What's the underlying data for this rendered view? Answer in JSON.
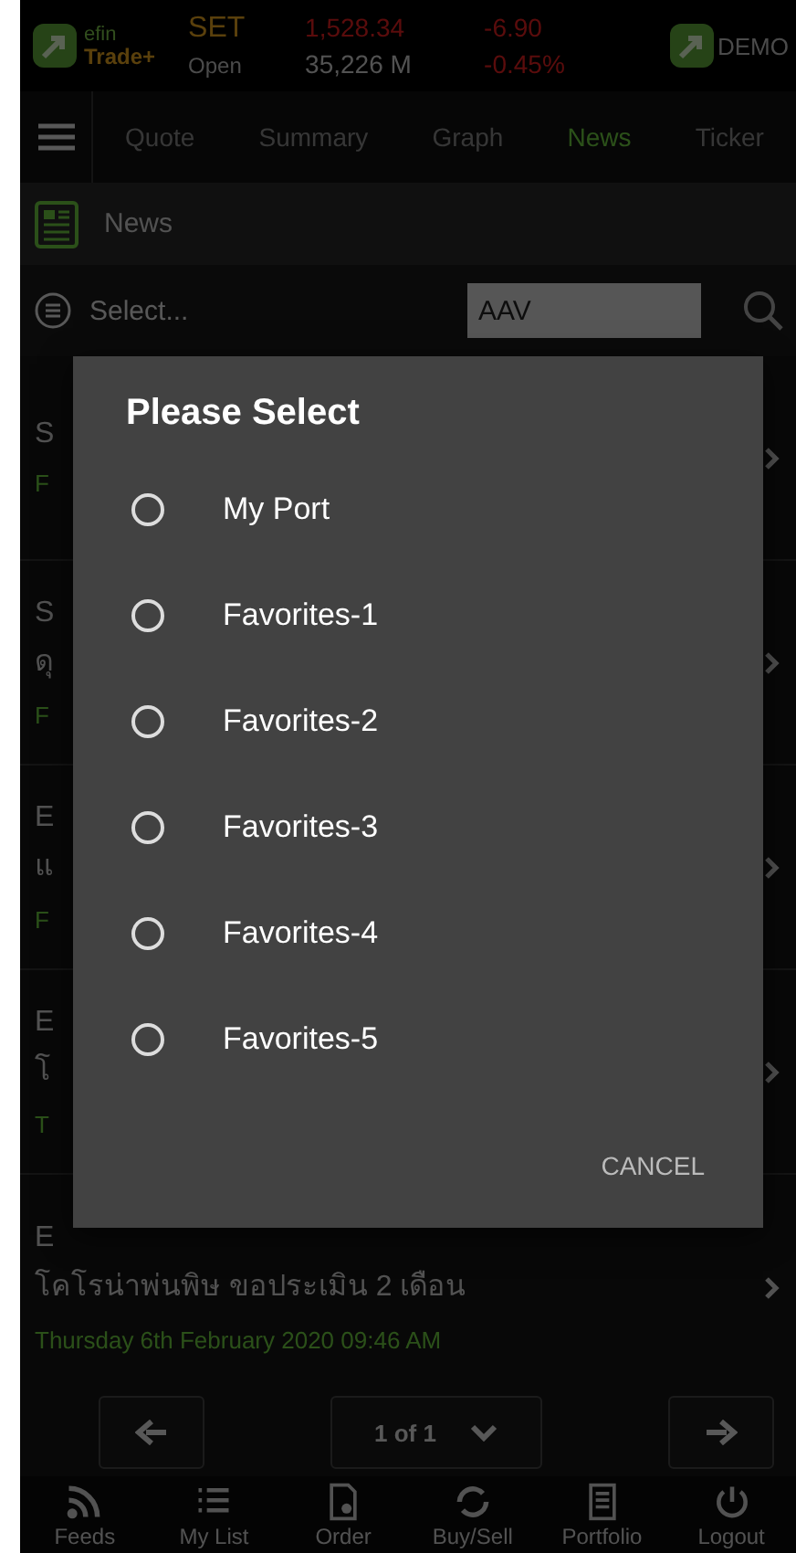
{
  "header": {
    "logo_top": "efin",
    "logo_bottom": "Trade+",
    "index": "SET",
    "market_state": "Open",
    "index_value": "1,528.34",
    "volume": "35,226 M",
    "change": "-6.90",
    "change_percent": "-0.45%",
    "account": "DEMO"
  },
  "tabs": [
    {
      "label": "Quote",
      "selected": false
    },
    {
      "label": "Summary",
      "selected": false
    },
    {
      "label": "Graph",
      "selected": false
    },
    {
      "label": "News",
      "selected": true
    },
    {
      "label": "Ticker",
      "selected": false
    }
  ],
  "section_title": "News",
  "filter": {
    "value": "Select...",
    "symbol": "AAV"
  },
  "news": [
    {
      "lines": [
        "S"
      ],
      "date": "F"
    },
    {
      "lines": [
        "S",
        "ดุ"
      ],
      "date": "F"
    },
    {
      "lines": [
        "E",
        "แ"
      ],
      "date": "F"
    },
    {
      "lines": [
        "E",
        "โ"
      ],
      "date": "T"
    },
    {
      "lines": [
        "E",
        "โคโรน่าพ่นพิษ ขอประเมิน 2 เดือน"
      ],
      "date": "Thursday 6th February 2020 09:46 AM"
    }
  ],
  "pager": {
    "page": "1 of 1"
  },
  "bottom_nav": [
    {
      "label": "Feeds",
      "kind": "feeds"
    },
    {
      "label": "My List",
      "kind": "list"
    },
    {
      "label": "Order",
      "kind": "order"
    },
    {
      "label": "Buy/Sell",
      "kind": "exchange"
    },
    {
      "label": "Portfolio",
      "kind": "portfolio"
    },
    {
      "label": "Logout",
      "kind": "power"
    }
  ],
  "dialog": {
    "title": "Please Select",
    "options": [
      {
        "label": "My Port",
        "selected": false
      },
      {
        "label": "Favorites-1",
        "selected": false
      },
      {
        "label": "Favorites-2",
        "selected": false
      },
      {
        "label": "Favorites-3",
        "selected": false
      },
      {
        "label": "Favorites-4",
        "selected": false
      },
      {
        "label": "Favorites-5",
        "selected": false
      }
    ],
    "cancel": "CANCEL"
  }
}
